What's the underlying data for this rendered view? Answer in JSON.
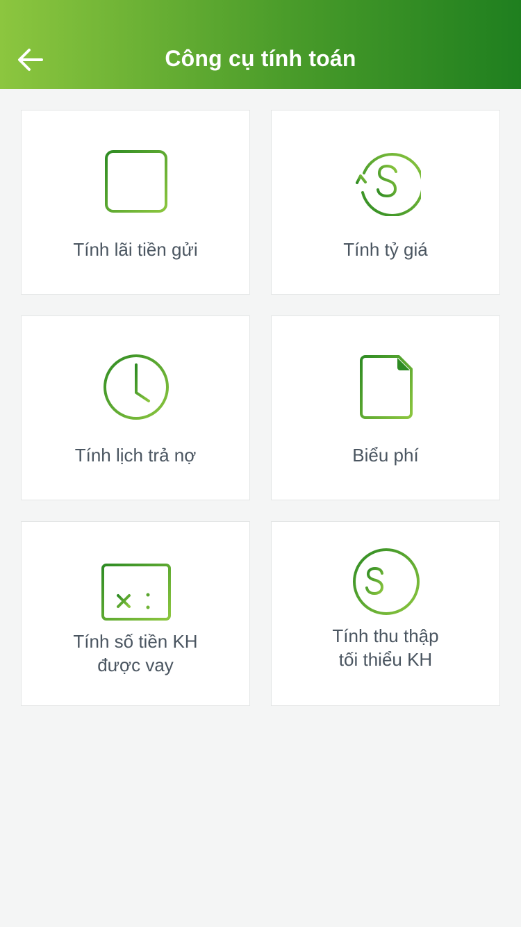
{
  "header": {
    "title": "Công cụ tính toán",
    "back_icon": "arrow-left-icon"
  },
  "colors": {
    "header_gradient_start": "#8cc63f",
    "header_gradient_end": "#1f7f1f",
    "icon_green_dark": "#2e8b23",
    "icon_green_light": "#8cc63f",
    "label_text": "#4a5560",
    "background": "#f4f5f5"
  },
  "tiles": [
    {
      "icon": "calendar-icon",
      "label": "Tính lãi tiền gửi"
    },
    {
      "icon": "currency-exchange-icon",
      "label": "Tính tỷ giá"
    },
    {
      "icon": "clock-icon",
      "label": "Tính lịch trả nợ"
    },
    {
      "icon": "document-icon",
      "label": "Biểu phí"
    },
    {
      "icon": "calculator-icon",
      "label_lines": [
        "Tính số tiền KH",
        "được vay"
      ]
    },
    {
      "icon": "money-calculation-icon",
      "label_lines": [
        "Tính thu thập",
        "tối thiểu KH"
      ]
    }
  ]
}
